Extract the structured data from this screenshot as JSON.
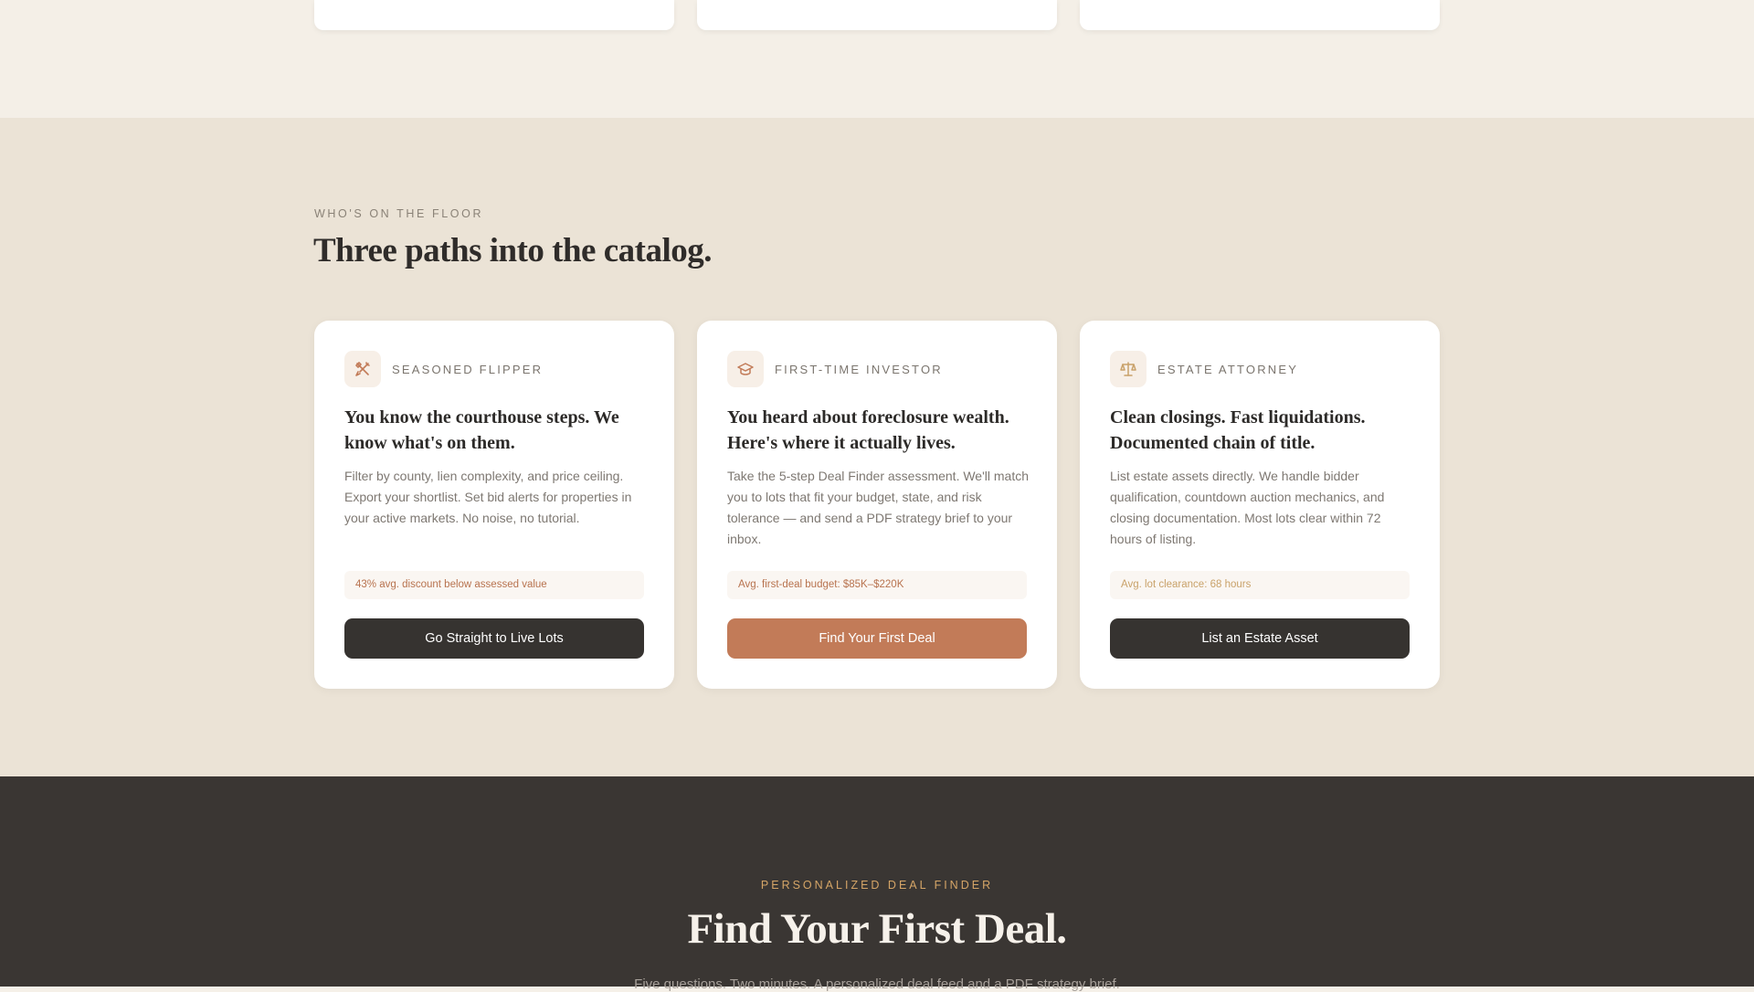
{
  "paths_section": {
    "eyebrow": "WHO'S ON THE FLOOR",
    "title": "Three paths into the catalog."
  },
  "cards": [
    {
      "icon": "tools-icon",
      "role": "SEASONED FLIPPER",
      "title": "You know the courthouse steps. We know what's on them.",
      "body": "Filter by county, lien complexity, and price ceiling. Export your shortlist. Set bid alerts for properties in your active markets. No noise, no tutorial.",
      "stat": "43% avg. discount below assessed value",
      "stat_color": "#b8734f",
      "cta": "Go Straight to Live Lots",
      "cta_style": "dark"
    },
    {
      "icon": "graduation-cap-icon",
      "role": "FIRST-TIME INVESTOR",
      "title": "You heard about foreclosure wealth. Here's where it actually lives.",
      "body": "Take the 5-step Deal Finder assessment. We'll match you to lots that fit your budget, state, and risk tolerance — and send a PDF strategy brief to your inbox.",
      "stat": "Avg. first-deal budget: $85K–$220K",
      "stat_color": "#b8734f",
      "cta": "Find Your First Deal",
      "cta_style": "accent"
    },
    {
      "icon": "scales-icon",
      "role": "ESTATE ATTORNEY",
      "title": "Clean closings. Fast liquidations. Documented chain of title.",
      "body": "List estate assets directly. We handle bidder qualification, countdown auction mechanics, and closing documentation. Most lots clear within 72 hours of listing.",
      "stat": "Avg. lot clearance: 68 hours",
      "stat_color": "#c9a26a",
      "cta": "List an Estate Asset",
      "cta_style": "dark"
    }
  ],
  "finder_section": {
    "eyebrow": "PERSONALIZED DEAL FINDER",
    "title": "Find Your First Deal.",
    "subtitle": "Five questions. Two minutes. A personalized deal feed and a PDF strategy brief."
  },
  "colors": {
    "accent": "#c27b58",
    "dark": "#363330",
    "gold": "#d5a567"
  }
}
